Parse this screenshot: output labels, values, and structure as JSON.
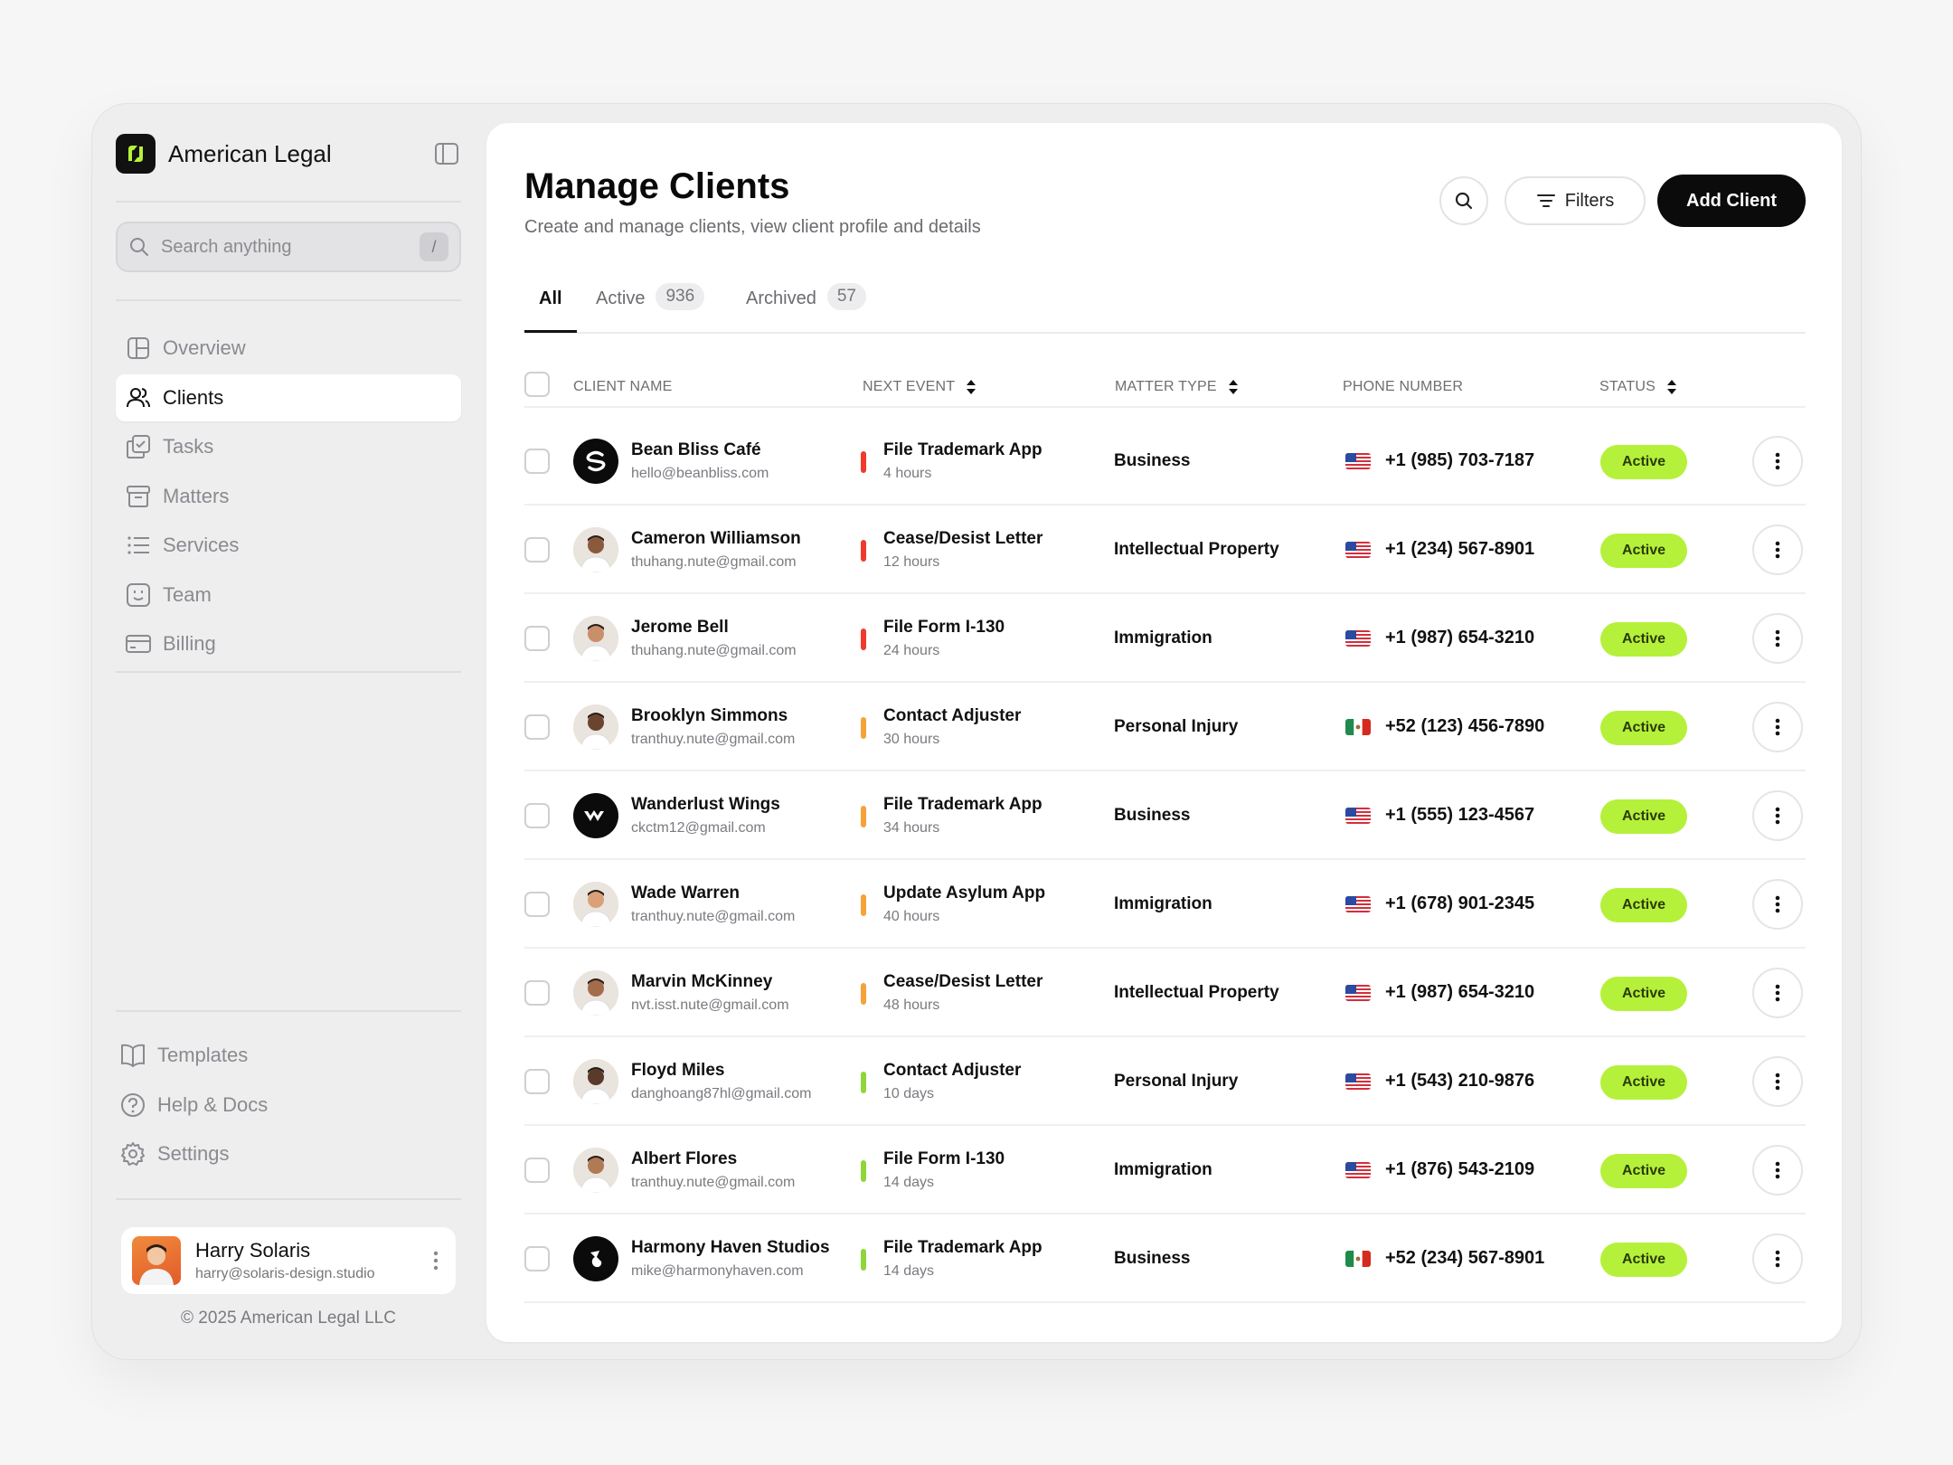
{
  "app": {
    "brand_name": "American Legal"
  },
  "sidebar": {
    "search_placeholder": "Search anything",
    "search_shortcut": "/",
    "items": [
      {
        "label": "Overview",
        "icon": "layout-icon"
      },
      {
        "label": "Clients",
        "icon": "users-icon",
        "active": true
      },
      {
        "label": "Tasks",
        "icon": "tasks-icon"
      },
      {
        "label": "Matters",
        "icon": "archive-icon"
      },
      {
        "label": "Services",
        "icon": "list-icon"
      },
      {
        "label": "Team",
        "icon": "team-icon"
      },
      {
        "label": "Billing",
        "icon": "card-icon"
      }
    ],
    "bottom_items": [
      {
        "label": "Templates",
        "icon": "book-icon"
      },
      {
        "label": "Help & Docs",
        "icon": "help-icon"
      },
      {
        "label": "Settings",
        "icon": "gear-icon"
      }
    ],
    "user": {
      "name": "Harry Solaris",
      "email": "harry@solaris-design.studio"
    },
    "copyright": "© 2025 American Legal LLC"
  },
  "main": {
    "title": "Manage Clients",
    "subtitle": "Create and manage clients, view client profile and details",
    "filters_label": "Filters",
    "add_label": "Add Client",
    "tabs": [
      {
        "label": "All",
        "count": null,
        "active": true
      },
      {
        "label": "Active",
        "count": "936"
      },
      {
        "label": "Archived",
        "count": "57"
      }
    ],
    "columns": {
      "client_name": "CLIENT NAME",
      "next_event": "NEXT EVENT",
      "matter_type": "MATTER TYPE",
      "phone_number": "PHONE NUMBER",
      "status": "STATUS"
    },
    "clients": [
      {
        "name": "Bean Bliss Café",
        "email": "hello@beanbliss.com",
        "avatar": "logo-s",
        "event": "File Trademark App",
        "event_time": "4 hours",
        "urgency": "#ef3b2d",
        "matter": "Business",
        "flag": "us",
        "phone": "+1 (985) 703-7187",
        "status": "Active"
      },
      {
        "name": "Cameron Williamson",
        "email": "thuhang.nute@gmail.com",
        "avatar": "person",
        "event": "Cease/Desist Letter",
        "event_time": "12 hours",
        "urgency": "#ef3b2d",
        "matter": "Intellectual Property",
        "flag": "us",
        "phone": "+1 (234) 567-8901",
        "status": "Active"
      },
      {
        "name": "Jerome Bell",
        "email": "thuhang.nute@gmail.com",
        "avatar": "person",
        "event": "File Form I-130",
        "event_time": "24 hours",
        "urgency": "#ef3b2d",
        "matter": "Immigration",
        "flag": "us",
        "phone": "+1 (987) 654-3210",
        "status": "Active"
      },
      {
        "name": "Brooklyn Simmons",
        "email": "tranthuy.nute@gmail.com",
        "avatar": "person",
        "event": "Contact Adjuster",
        "event_time": "30 hours",
        "urgency": "#f5a23a",
        "matter": "Personal Injury",
        "flag": "mx",
        "phone": "+52 (123) 456-7890",
        "status": "Active"
      },
      {
        "name": "Wanderlust Wings",
        "email": "ckctm12@gmail.com",
        "avatar": "logo-w",
        "event": "File Trademark App",
        "event_time": "34 hours",
        "urgency": "#f5a23a",
        "matter": "Business",
        "flag": "us",
        "phone": "+1 (555) 123-4567",
        "status": "Active"
      },
      {
        "name": "Wade Warren",
        "email": "tranthuy.nute@gmail.com",
        "avatar": "person",
        "event": "Update Asylum App",
        "event_time": "40 hours",
        "urgency": "#f5a23a",
        "matter": "Immigration",
        "flag": "us",
        "phone": "+1 (678) 901-2345",
        "status": "Active"
      },
      {
        "name": "Marvin McKinney",
        "email": "nvt.isst.nute@gmail.com",
        "avatar": "person",
        "event": "Cease/Desist Letter",
        "event_time": "48 hours",
        "urgency": "#f5a23a",
        "matter": "Intellectual Property",
        "flag": "us",
        "phone": "+1 (987) 654-3210",
        "status": "Active"
      },
      {
        "name": "Floyd Miles",
        "email": "danghoang87hl@gmail.com",
        "avatar": "person",
        "event": "Contact Adjuster",
        "event_time": "10 days",
        "urgency": "#8fd63a",
        "matter": "Personal Injury",
        "flag": "us",
        "phone": "+1 (543) 210-9876",
        "status": "Active"
      },
      {
        "name": "Albert Flores",
        "email": "tranthuy.nute@gmail.com",
        "avatar": "person",
        "event": "File Form I-130",
        "event_time": "14 days",
        "urgency": "#8fd63a",
        "matter": "Immigration",
        "flag": "us",
        "phone": "+1 (876) 543-2109",
        "status": "Active"
      },
      {
        "name": "Harmony Haven Studios",
        "email": "mike@harmonyhaven.com",
        "avatar": "logo-h",
        "event": "File Trademark App",
        "event_time": "14 days",
        "urgency": "#8fd63a",
        "matter": "Business",
        "flag": "mx",
        "phone": "+52 (234) 567-8901",
        "status": "Active"
      }
    ]
  },
  "colors": {
    "status_active": "#b5f13a",
    "brand_logo": "#b5f13a",
    "primary_button": "#0b0b0b"
  }
}
